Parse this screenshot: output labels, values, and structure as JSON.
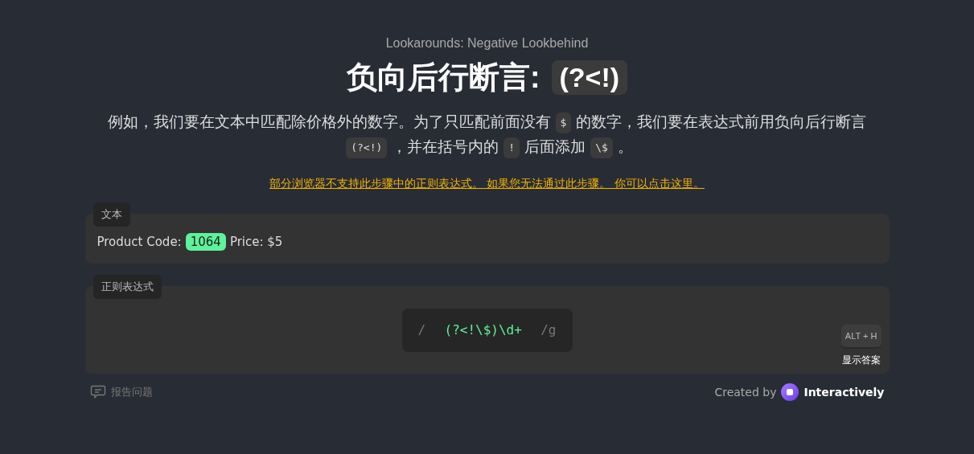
{
  "subtitle": "Lookarounds: Negative Lookbehind",
  "title": {
    "text": "负向后行断言:",
    "code": "(?<!)"
  },
  "description": [
    {
      "kind": "text",
      "text": "例如，我们要在文本中匹配除价格外的数字。为了只匹配前面没有"
    },
    {
      "kind": "code",
      "text": "$"
    },
    {
      "kind": "text",
      "text": "的数字，我们要在表达式前用负向后行断言"
    },
    {
      "kind": "code",
      "text": "(?<!)"
    },
    {
      "kind": "text",
      "text": "，并在括号内的"
    },
    {
      "kind": "code",
      "text": "!"
    },
    {
      "kind": "text",
      "text": "后面添加"
    },
    {
      "kind": "code",
      "text": "\\$"
    },
    {
      "kind": "text",
      "text": "。"
    }
  ],
  "warning_link": "部分浏览器不支持此步骤中的正则表达式。 如果您无法通过此步骤。 你可以点击这里。",
  "text_panel": {
    "label": "文本",
    "segments": [
      {
        "text": "Product Code:",
        "highlighted": false
      },
      {
        "text": "1064",
        "highlighted": true
      },
      {
        "text": "Price: $5",
        "highlighted": false
      }
    ]
  },
  "regex_panel": {
    "label": "正则表达式",
    "open_delimiter": "/",
    "value": "(?<!\\$)\\d+",
    "flags": "/g",
    "shortcut": "ALT + H",
    "hint_label": "显示答案"
  },
  "footer": {
    "report": "报告问题",
    "created_by": "Created by",
    "brand": "Interactively"
  }
}
